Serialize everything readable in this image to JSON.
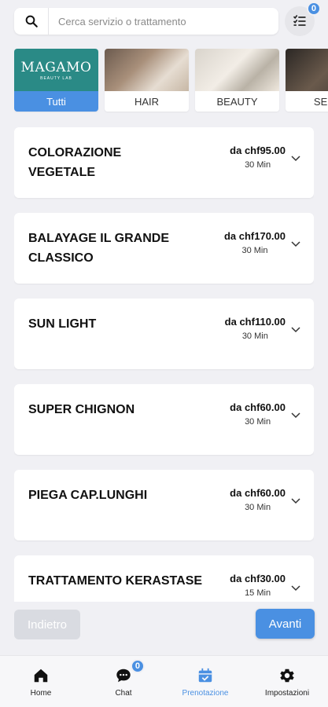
{
  "search": {
    "placeholder": "Cerca servizio o trattamento"
  },
  "cart": {
    "badge": "0",
    "icon": "list-icon"
  },
  "categories": [
    {
      "label": "Tutti",
      "logo_text": "MAGAMO",
      "logo_sub": "BEAUTY LAB",
      "active": true
    },
    {
      "label": "HAIR",
      "active": false
    },
    {
      "label": "BEAUTY",
      "active": false
    },
    {
      "label": "SERV",
      "active": false
    }
  ],
  "services": [
    {
      "name": "COLORAZIONE VEGETALE",
      "price": "da chf95.00",
      "duration": "30 Min"
    },
    {
      "name": "BALAYAGE IL GRANDE CLASSICO",
      "price": "da chf170.00",
      "duration": "30 Min"
    },
    {
      "name": "SUN LIGHT",
      "price": "da chf110.00",
      "duration": "30 Min"
    },
    {
      "name": "SUPER CHIGNON",
      "price": "da chf60.00",
      "duration": "30 Min"
    },
    {
      "name": "PIEGA CAP.LUNGHI",
      "price": "da chf60.00",
      "duration": "30 Min"
    },
    {
      "name": "TRATTAMENTO KERASTASE",
      "price": "da chf30.00",
      "duration": "15 Min"
    }
  ],
  "buttons": {
    "back": "Indietro",
    "next": "Avanti"
  },
  "nav": {
    "items": [
      {
        "label": "Home",
        "icon": "home-icon"
      },
      {
        "label": "Chat",
        "icon": "chat-icon",
        "badge": "0"
      },
      {
        "label": "Prenotazione",
        "icon": "calendar-icon",
        "active": true
      },
      {
        "label": "Impostazioni",
        "icon": "gear-icon"
      }
    ]
  },
  "colors": {
    "accent": "#4a90e2",
    "background": "#f0f0f4",
    "logo": "#2a8a86"
  }
}
